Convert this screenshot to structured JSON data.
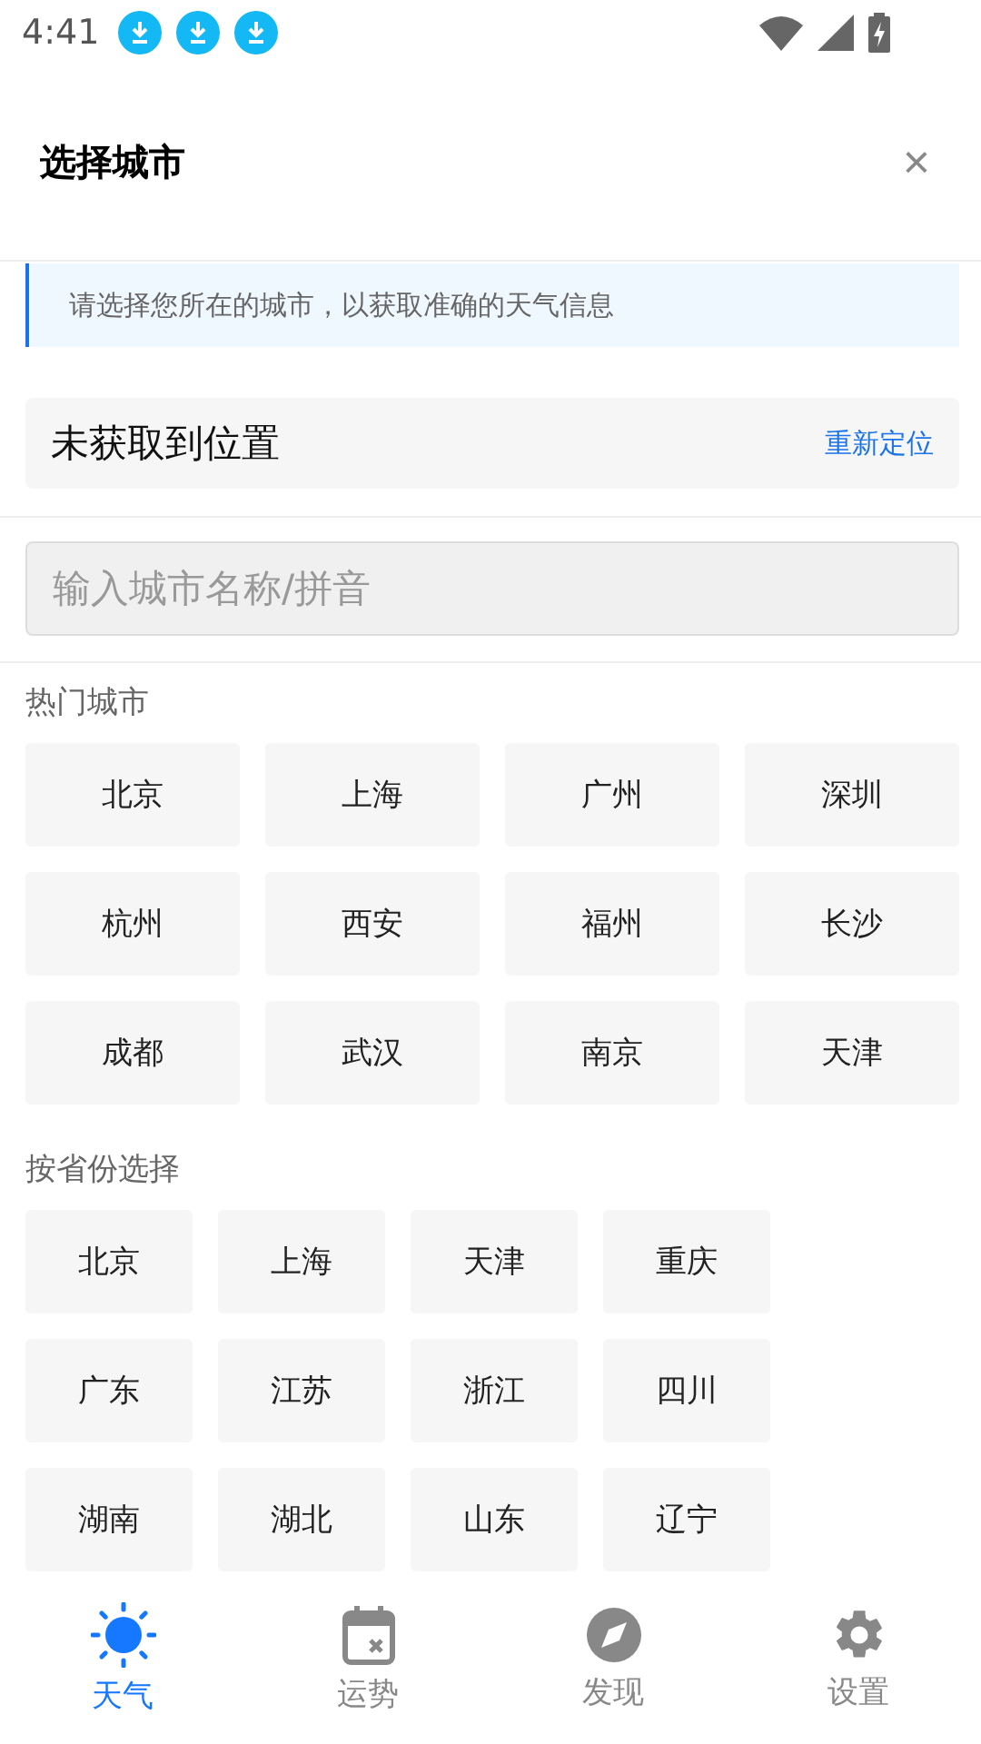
{
  "status_bar": {
    "time": "4:41",
    "notifications": [
      {
        "kind": "download"
      },
      {
        "kind": "download"
      },
      {
        "kind": "download"
      }
    ]
  },
  "header": {
    "title": "选择城市",
    "close": "×"
  },
  "notice": "请选择您所在的城市，以获取准确的天气信息",
  "location": {
    "status": "未获取到位置",
    "action": "重新定位"
  },
  "search": {
    "placeholder": "输入城市名称/拼音"
  },
  "hot_cities": {
    "title": "热门城市",
    "items": [
      "北京",
      "上海",
      "广州",
      "深圳",
      "杭州",
      "西安",
      "福州",
      "长沙",
      "成都",
      "武汉",
      "南京",
      "天津"
    ]
  },
  "provinces": {
    "title": "按省份选择",
    "items": [
      "北京",
      "上海",
      "天津",
      "重庆",
      "广东",
      "江苏",
      "浙江",
      "四川",
      "湖南",
      "湖北",
      "山东",
      "辽宁"
    ]
  },
  "tabs": [
    {
      "label": "天气",
      "kind": "sun",
      "selected": true
    },
    {
      "label": "运势",
      "kind": "calendar",
      "selected": false
    },
    {
      "label": "发现",
      "kind": "compass",
      "selected": false
    },
    {
      "label": "设置",
      "kind": "gear",
      "selected": false
    }
  ]
}
